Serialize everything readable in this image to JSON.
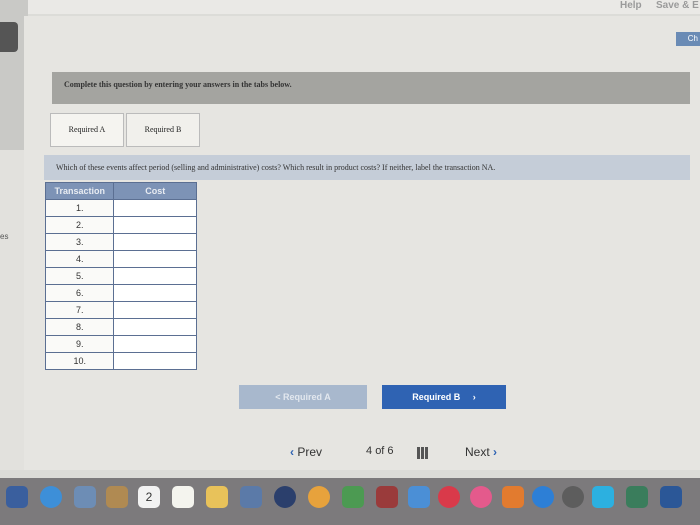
{
  "topbar": {
    "help": "Help",
    "save": "Save & E"
  },
  "side": {
    "ch_button": "Ch",
    "left_label": "es"
  },
  "instructions": "Complete this question by entering your answers in the tabs below.",
  "tabs": [
    {
      "label": "Required A"
    },
    {
      "label": "Required B"
    }
  ],
  "question": "Which of these events affect period (selling and administrative) costs? Which result in product costs? If neither, label the transaction NA.",
  "table": {
    "headers": [
      "Transaction",
      "Cost"
    ],
    "rows": [
      "1.",
      "2.",
      "3.",
      "4.",
      "5.",
      "6.",
      "7.",
      "8.",
      "9.",
      "10."
    ]
  },
  "nav": {
    "prev_required": "< Required A",
    "next_required": "Required B"
  },
  "pager": {
    "prev": "Prev",
    "current": "4",
    "of_label": "of 6",
    "next": "Next"
  },
  "dock": {
    "calendar_day": "2"
  },
  "colors": {
    "tab_nav_blue": "#2f63b3",
    "table_header": "#7d93b6",
    "question_bar": "#c5cdd8"
  }
}
